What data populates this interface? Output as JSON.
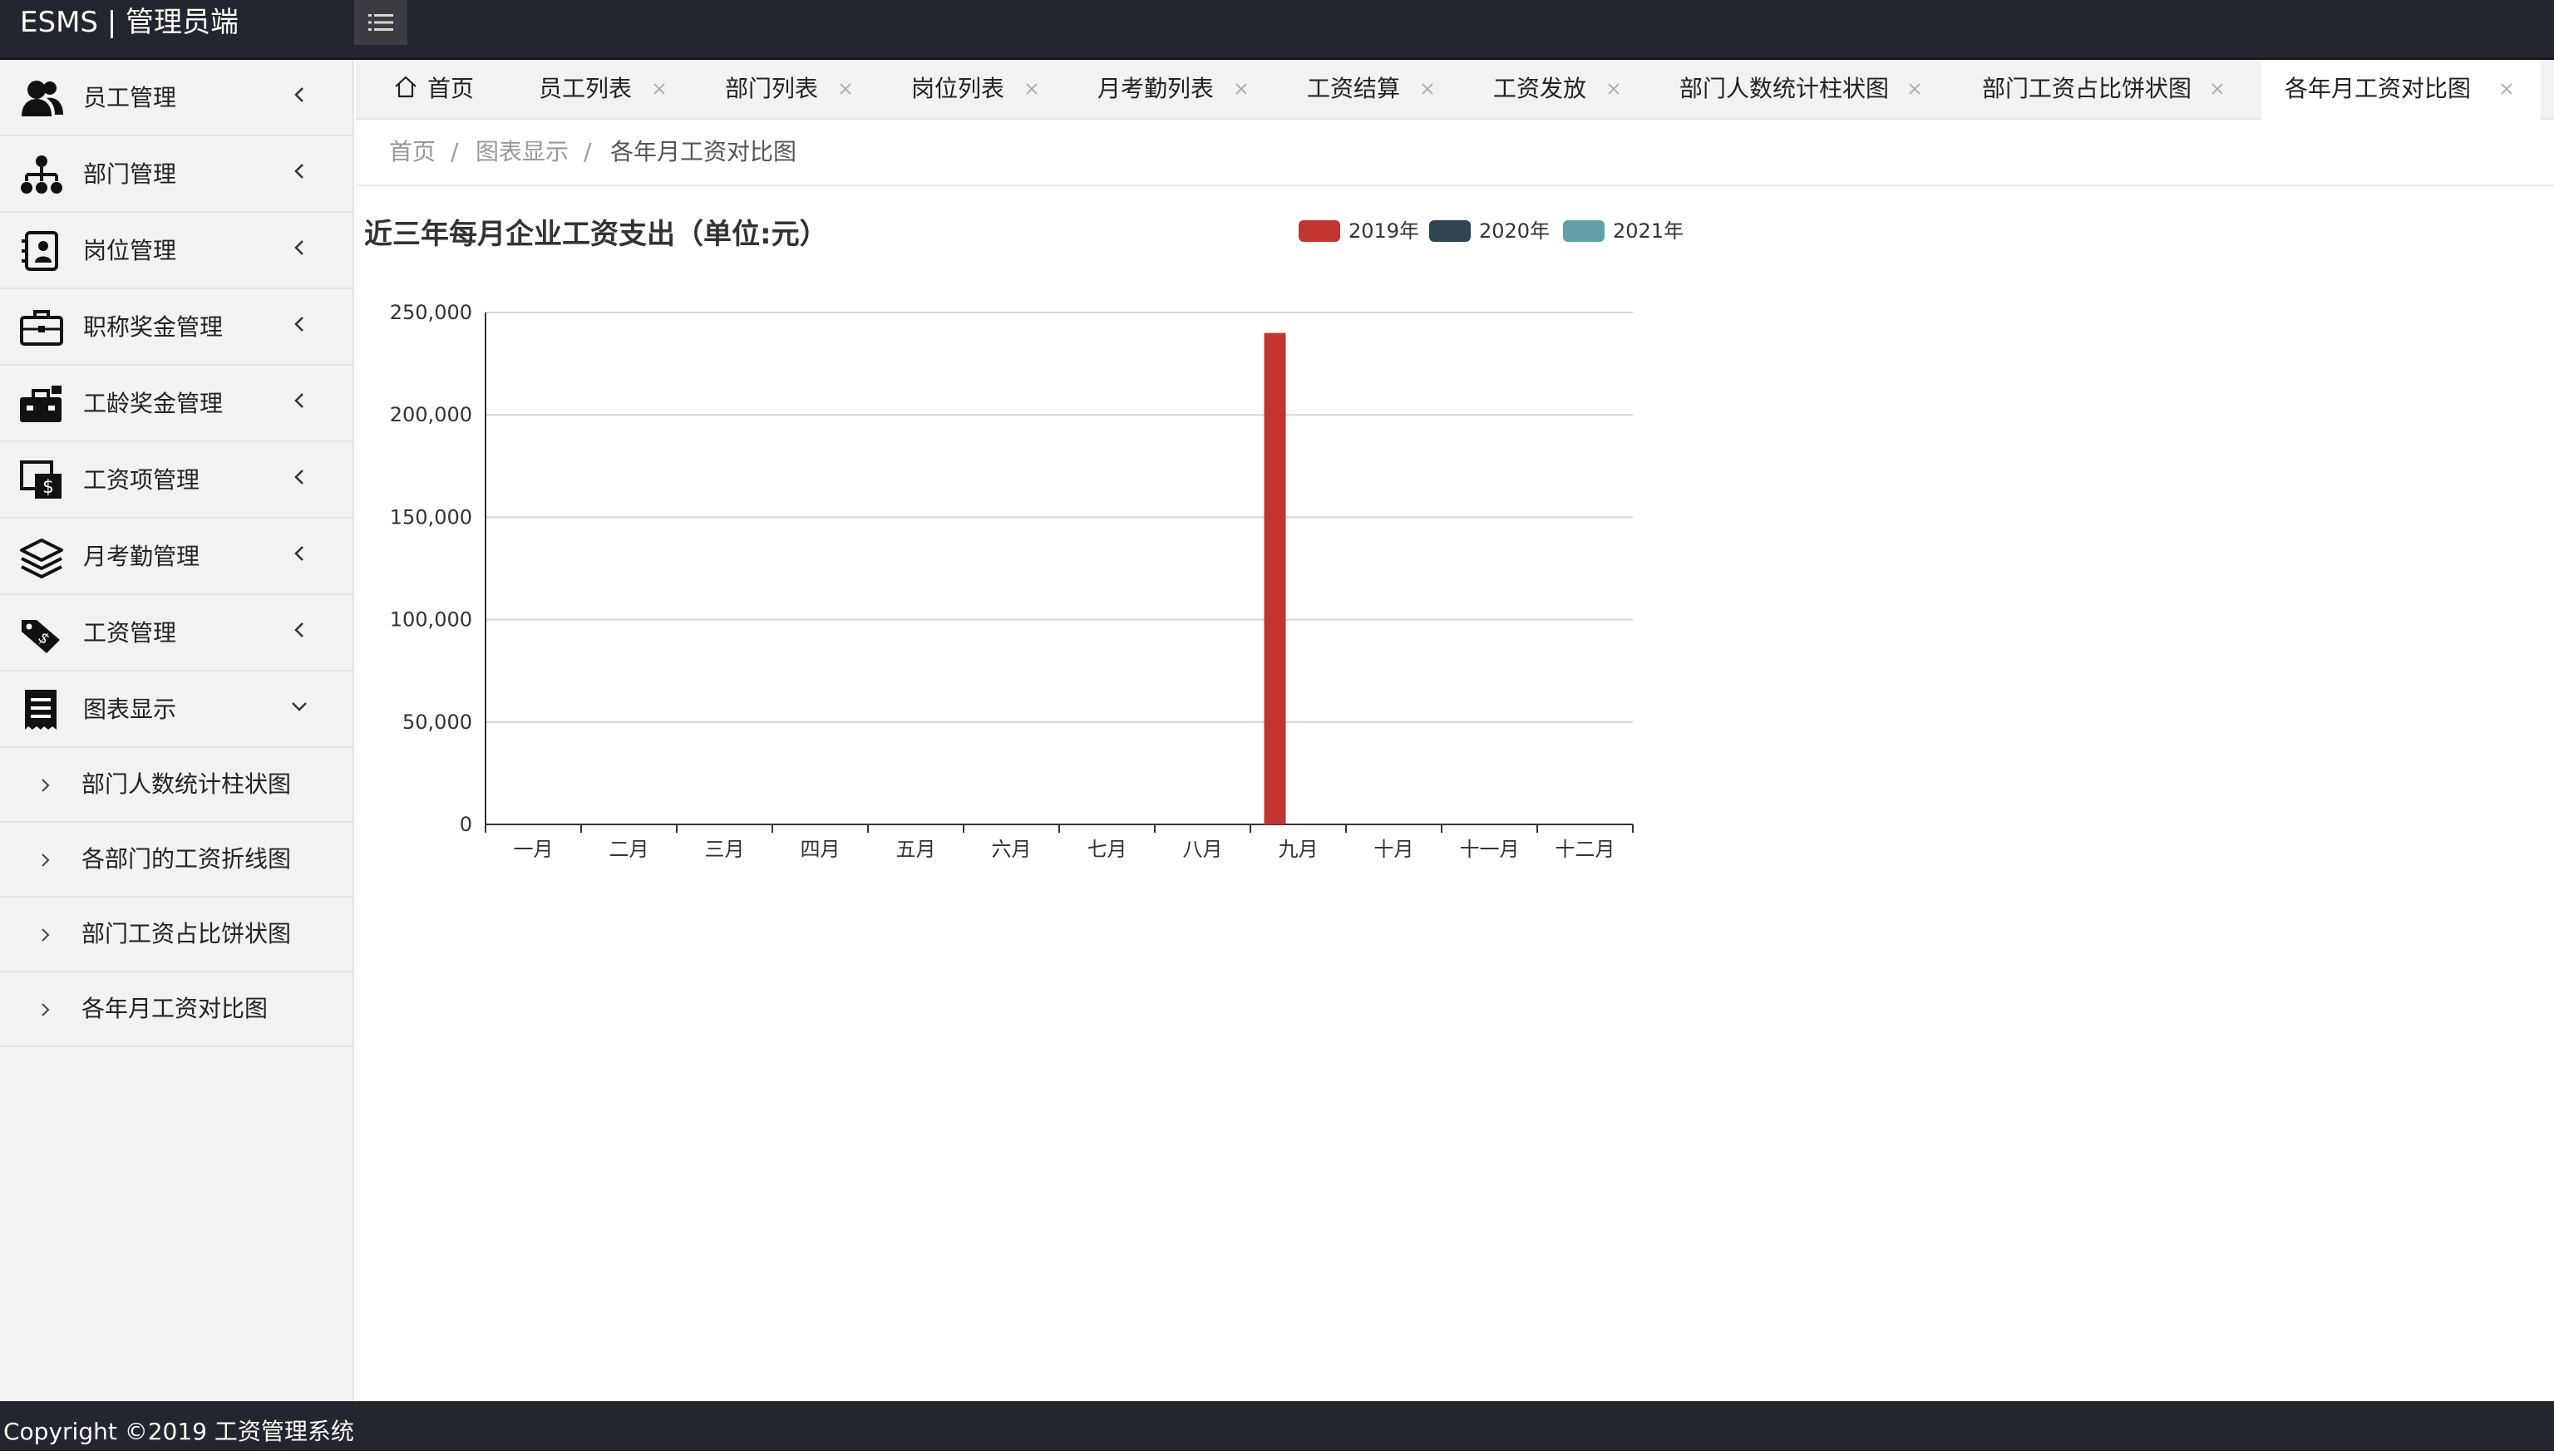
{
  "app": {
    "brand": "ESMS | 管理员端",
    "footer": "Copyright ©2019 工资管理系统"
  },
  "sidebar": {
    "items": [
      {
        "label": "员工管理",
        "icon": "users-icon"
      },
      {
        "label": "部门管理",
        "icon": "sitemap-icon"
      },
      {
        "label": "岗位管理",
        "icon": "badge-icon"
      },
      {
        "label": "职称奖金管理",
        "icon": "briefcase-icon"
      },
      {
        "label": "工龄奖金管理",
        "icon": "toolbox-icon"
      },
      {
        "label": "工资项管理",
        "icon": "salary-items-icon"
      },
      {
        "label": "月考勤管理",
        "icon": "layers-icon"
      },
      {
        "label": "工资管理",
        "icon": "tags-icon"
      },
      {
        "label": "图表显示",
        "icon": "receipt-icon",
        "expanded": true
      }
    ],
    "subitems": [
      {
        "label": "部门人数统计柱状图"
      },
      {
        "label": "各部门的工资折线图"
      },
      {
        "label": "部门工资占比饼状图"
      },
      {
        "label": "各年月工资对比图"
      }
    ]
  },
  "tabs": [
    {
      "label": "首页",
      "icon": "home-icon",
      "closable": false
    },
    {
      "label": "员工列表",
      "closable": true
    },
    {
      "label": "部门列表",
      "closable": true
    },
    {
      "label": "岗位列表",
      "closable": true
    },
    {
      "label": "月考勤列表",
      "closable": true
    },
    {
      "label": "工资结算",
      "closable": true
    },
    {
      "label": "工资发放",
      "closable": true
    },
    {
      "label": "部门人数统计柱状图",
      "closable": true
    },
    {
      "label": "部门工资占比饼状图",
      "closable": true
    },
    {
      "label": "各年月工资对比图",
      "closable": true,
      "active": true
    }
  ],
  "breadcrumb": {
    "items": [
      "首页",
      "图表显示",
      "各年月工资对比图"
    ],
    "separator": "/"
  },
  "chart_data": {
    "type": "bar",
    "title": "近三年每月企业工资支出（单位:元）",
    "categories": [
      "一月",
      "二月",
      "三月",
      "四月",
      "五月",
      "六月",
      "七月",
      "八月",
      "九月",
      "十月",
      "十一月",
      "十二月"
    ],
    "series": [
      {
        "name": "2019年",
        "color": "#c23531",
        "values": [
          0,
          0,
          0,
          0,
          0,
          0,
          0,
          0,
          240000,
          0,
          0,
          0
        ]
      },
      {
        "name": "2020年",
        "color": "#2f4554",
        "values": [
          0,
          0,
          0,
          0,
          0,
          0,
          0,
          0,
          0,
          0,
          0,
          0
        ]
      },
      {
        "name": "2021年",
        "color": "#61a0a8",
        "values": [
          0,
          0,
          0,
          0,
          0,
          0,
          0,
          0,
          0,
          0,
          0,
          0
        ]
      }
    ],
    "ylim": [
      0,
      250000
    ],
    "yticks": [
      "0",
      "50,000",
      "100,000",
      "150,000",
      "200,000",
      "250,000"
    ],
    "grid": true,
    "legend": "top"
  },
  "colors": {
    "topbar": "#23262e",
    "sidebar": "#f2f2f2",
    "accent": "#c23531"
  }
}
